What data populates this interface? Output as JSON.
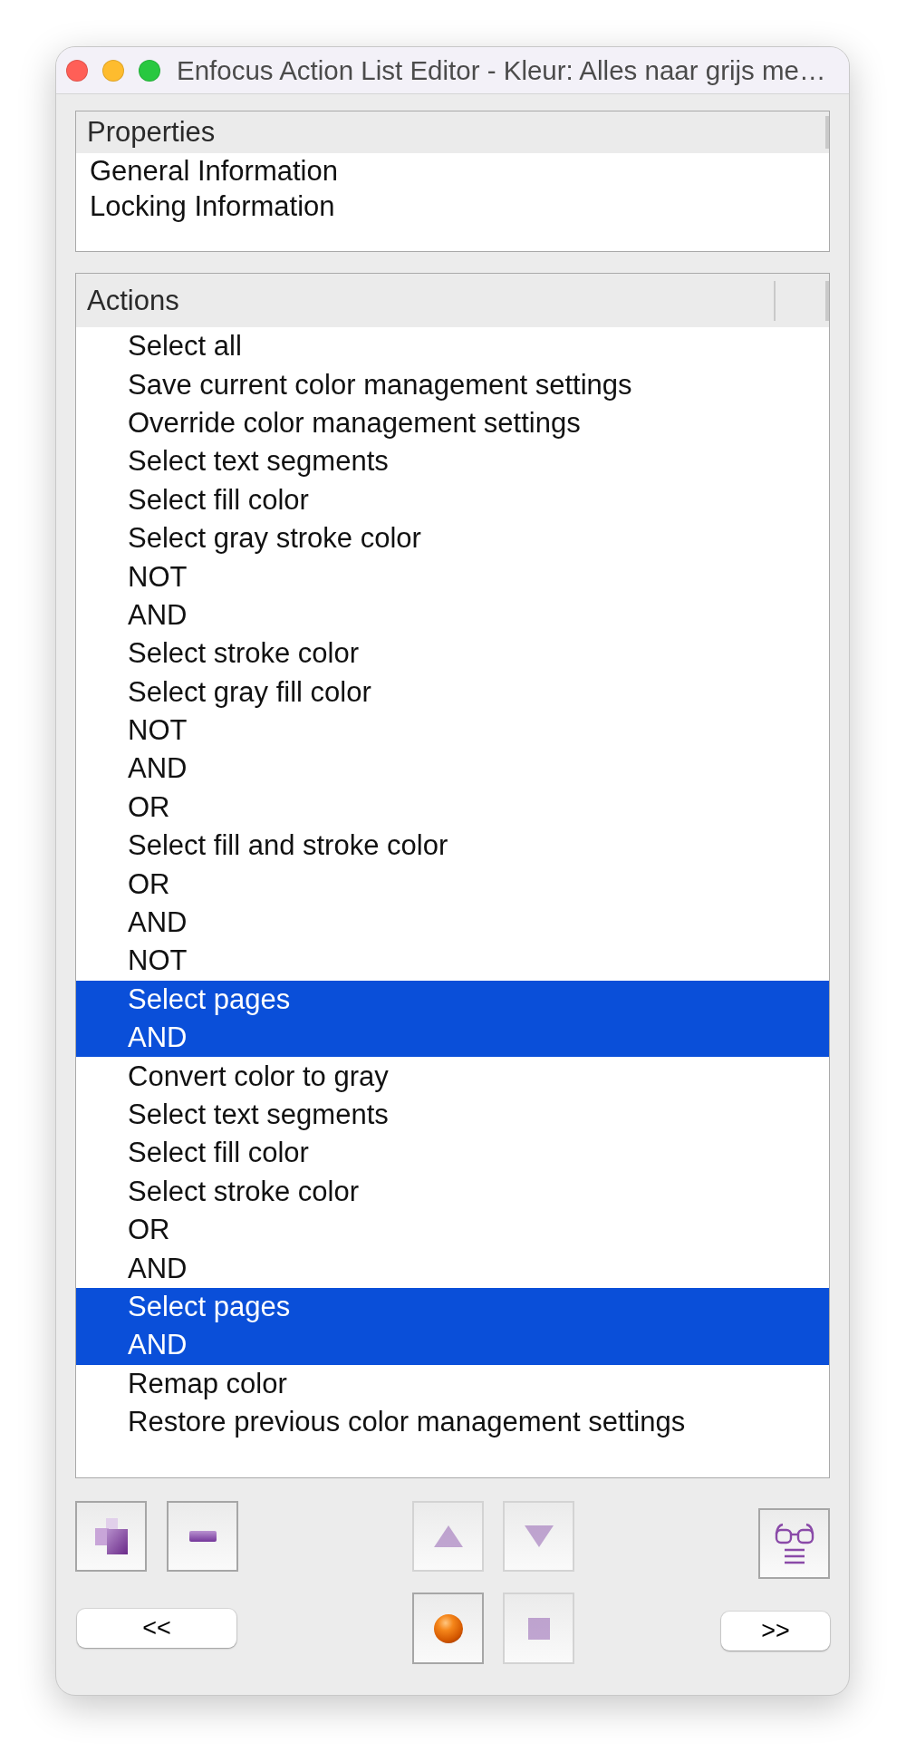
{
  "window": {
    "title": "Enfocus Action List Editor - Kleur: Alles naar grijs me…"
  },
  "properties": {
    "header": "Properties",
    "rows": [
      "General Information",
      "Locking Information"
    ]
  },
  "actions": {
    "header": "Actions",
    "rows": [
      {
        "label": "Select all",
        "selected": false
      },
      {
        "label": "Save current color management settings",
        "selected": false
      },
      {
        "label": "Override color management settings",
        "selected": false
      },
      {
        "label": "Select text segments",
        "selected": false
      },
      {
        "label": "Select fill color",
        "selected": false
      },
      {
        "label": "Select gray stroke color",
        "selected": false
      },
      {
        "label": "NOT",
        "selected": false
      },
      {
        "label": "AND",
        "selected": false
      },
      {
        "label": "Select stroke color",
        "selected": false
      },
      {
        "label": "Select gray fill color",
        "selected": false
      },
      {
        "label": "NOT",
        "selected": false
      },
      {
        "label": "AND",
        "selected": false
      },
      {
        "label": "OR",
        "selected": false
      },
      {
        "label": "Select fill and stroke color",
        "selected": false
      },
      {
        "label": "OR",
        "selected": false
      },
      {
        "label": "AND",
        "selected": false
      },
      {
        "label": "NOT",
        "selected": false
      },
      {
        "label": "Select pages",
        "selected": true
      },
      {
        "label": "AND",
        "selected": true
      },
      {
        "label": "Convert color to gray",
        "selected": false
      },
      {
        "label": "Select text segments",
        "selected": false
      },
      {
        "label": "Select fill color",
        "selected": false
      },
      {
        "label": "Select stroke color",
        "selected": false
      },
      {
        "label": "OR",
        "selected": false
      },
      {
        "label": "AND",
        "selected": false
      },
      {
        "label": "Select pages",
        "selected": true
      },
      {
        "label": "AND",
        "selected": true
      },
      {
        "label": "Remap color",
        "selected": false
      },
      {
        "label": "Restore previous color management settings",
        "selected": false
      }
    ]
  },
  "tool_buttons": [
    {
      "disabled": false
    },
    {
      "disabled": false
    },
    {
      "disabled": true
    },
    {
      "disabled": true
    },
    {
      "disabled": false
    },
    {
      "disabled": false
    },
    {
      "disabled": true
    }
  ],
  "nav_buttons": [
    "<<",
    ">>"
  ]
}
